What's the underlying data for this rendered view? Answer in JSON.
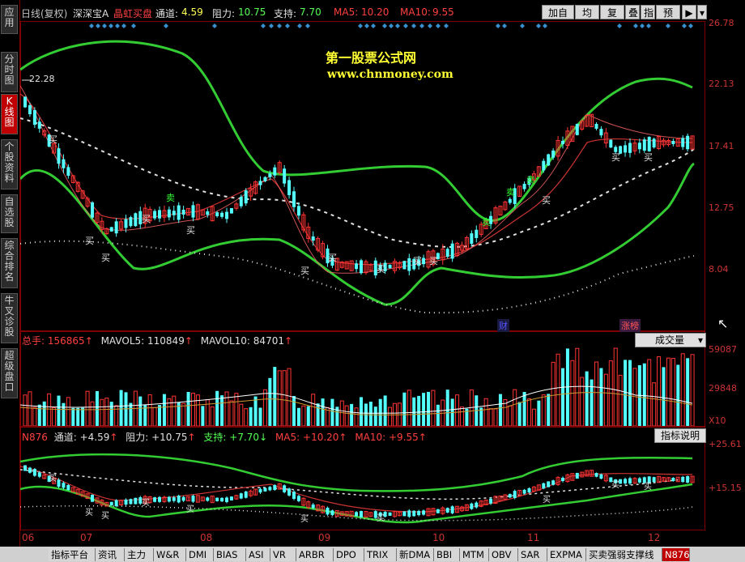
{
  "left_tabs": [
    {
      "label": "应用"
    },
    {
      "label": "分时图"
    },
    {
      "label": "K线图"
    },
    {
      "label": "个股资料"
    },
    {
      "label": "自选股"
    },
    {
      "label": "综合排名"
    },
    {
      "label": "牛叉诊股"
    },
    {
      "label": "超级盘口"
    }
  ],
  "header": {
    "period": "日线(复权)",
    "stock": "深深宝A",
    "signal": "晶虹买盘",
    "channel_label": "通道:",
    "channel_value": "4.59",
    "resist_label": "阻力:",
    "resist_value": "10.75",
    "support_label": "支持:",
    "support_value": "7.70",
    "ma5_label": "MA5:",
    "ma5_value": "10.20",
    "ma10_label": "MA10:",
    "ma10_value": "9.55"
  },
  "toolbar": {
    "add_fav": "加自选",
    "avg": "均线",
    "fq": "复权",
    "overlay": "叠",
    "indicator": "指标",
    "forecast": "预测"
  },
  "watermark": {
    "line1": "第一股票公式网",
    "line2": "www.chnmoney.com"
  },
  "main_axis": [
    "26.78",
    "22.13",
    "17.41",
    "12.75",
    "8.04"
  ],
  "main_annotations": {
    "high_price": "22.28",
    "cai": "财",
    "zhangbang": "涨榜",
    "buy": "买",
    "sell": "卖"
  },
  "volume": {
    "total_label": "总手:",
    "total_value": "156865",
    "mavol5_label": "MAVOL5:",
    "mavol5_value": "110849",
    "mavol10_label": "MAVOL10:",
    "mavol10_value": "84701",
    "indicator_select": "成交量",
    "axis": [
      "59087",
      "29848",
      "X10"
    ]
  },
  "lower": {
    "name": "N876",
    "channel": "通道: +4.59",
    "resist": "阻力: +10.75",
    "support": "支持: +7.70",
    "ma5": "MA5: +10.20",
    "ma10": "MA10: +9.55",
    "help": "指标说明",
    "axis": [
      "+25.61",
      "+15.15"
    ]
  },
  "x_axis": [
    "06",
    "07",
    "08",
    "09",
    "10",
    "11",
    "12"
  ],
  "bottom_tabs": [
    "指标平台",
    "资讯",
    "主力",
    "W&R",
    "DMI",
    "BIAS",
    "ASI",
    "VR",
    "ARBR",
    "DPO",
    "TRIX",
    "新DMA",
    "BBI",
    "MTM",
    "OBV",
    "SAR",
    "EXPMA",
    "买卖强弱支撑线",
    "N876"
  ],
  "colors": {
    "up": "#ff3333",
    "down": "#54ffff",
    "band": "#33cc33",
    "ma5": "#ffffff",
    "ma10": "#cc3333",
    "accent": "#c00000"
  }
}
